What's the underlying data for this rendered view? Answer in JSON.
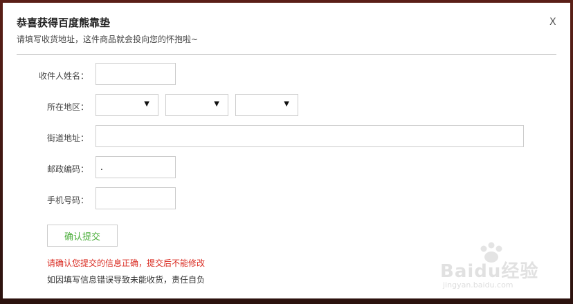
{
  "dialog": {
    "title": "恭喜获得百度熊靠垫",
    "subtitle": "请填写收货地址，这件商品就会投向您的怀抱啦~",
    "close_label": "X"
  },
  "form": {
    "name_label": "收件人姓名：",
    "name_value": "",
    "region_label": "所在地区：",
    "region_selects": [
      {
        "value": "",
        "caret": "▼"
      },
      {
        "value": "",
        "caret": "▼"
      },
      {
        "value": "",
        "caret": "▼"
      }
    ],
    "street_label": "街道地址：",
    "street_value": "",
    "postcode_label": "邮政编码：",
    "postcode_value": ".",
    "phone_label": "手机号码：",
    "phone_value": "",
    "submit_label": "确认提交"
  },
  "notices": {
    "warning": "请确认您提交的信息正确，提交后不能修改",
    "note": "如因填写信息错误导致未能收货，责任自负"
  },
  "watermark": {
    "brand": "Baidu经验",
    "url": "jingyan.baidu.com"
  },
  "colors": {
    "submit_text": "#4bae3b",
    "warning_text": "#d9281e"
  }
}
